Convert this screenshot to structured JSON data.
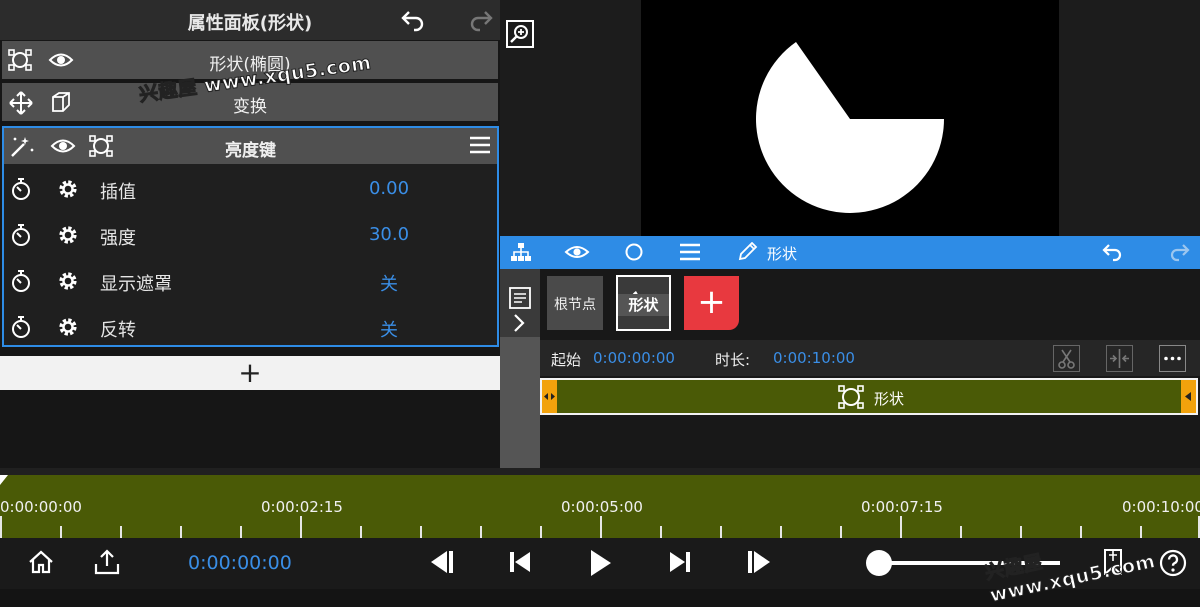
{
  "panel": {
    "title": "属性面板(形状)"
  },
  "layers": {
    "shape_label": "形状(椭圆)",
    "transform_label": "变换"
  },
  "effect": {
    "title": "亮度键",
    "params": [
      {
        "name": "插值",
        "value": "0.00"
      },
      {
        "name": "强度",
        "value": "30.0"
      },
      {
        "name": "显示遮罩",
        "value": "关"
      },
      {
        "name": "反转",
        "value": "关"
      }
    ]
  },
  "add_bar": {
    "label": "+"
  },
  "timeline_toolbar": {
    "shape_label": "形状"
  },
  "nodes": {
    "root": "根节点",
    "shape": "形状",
    "add": "+"
  },
  "clip_info": {
    "start_label": "起始",
    "start_value": "0:00:00:00",
    "duration_label": "时长:",
    "duration_value": "0:00:10:00"
  },
  "clip": {
    "name": "形状"
  },
  "ruler": {
    "labels": [
      "0:00:00:00",
      "0:00:02:15",
      "0:00:05:00",
      "0:00:07:15",
      "0:00:10:00"
    ]
  },
  "playback": {
    "current_time": "0:00:00:00"
  },
  "watermarks": {
    "top": "兴趣屋 www.xqu5.com",
    "bottom": "兴趣屋 www.xqu5.com"
  },
  "colors": {
    "accent": "#2e8ce6",
    "value_text": "#3a8ee6",
    "clip": "#4a5a06",
    "add_node": "#e8393f",
    "handle": "#f2a20c"
  }
}
